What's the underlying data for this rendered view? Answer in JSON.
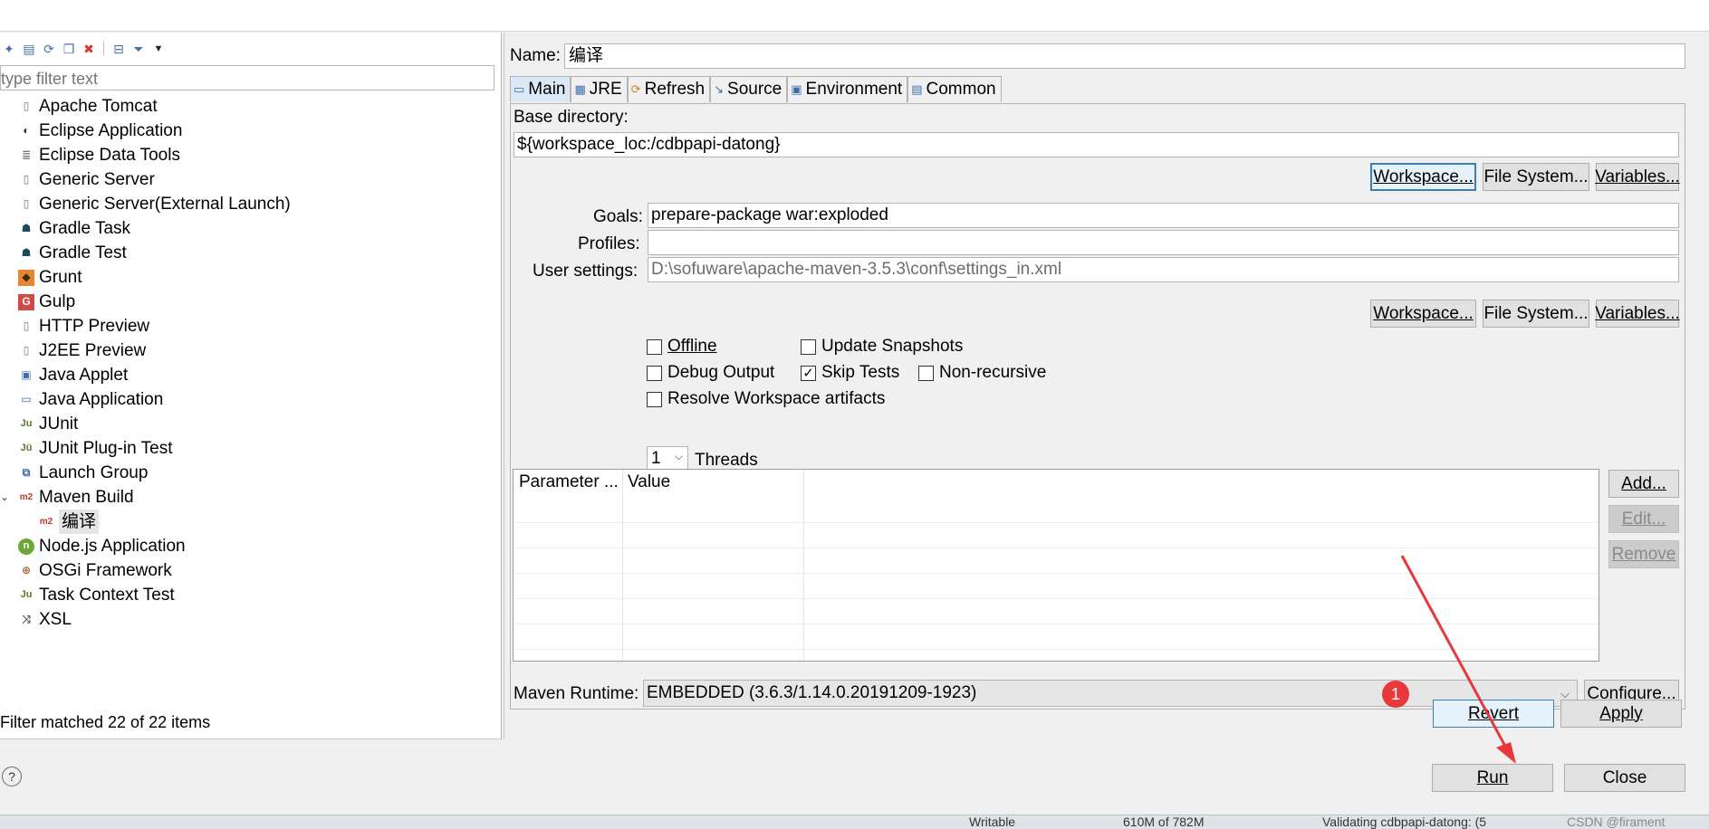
{
  "left_panel": {
    "filter_placeholder": "type filter text",
    "items": [
      {
        "label": "Apache Tomcat",
        "icon": "server-icon"
      },
      {
        "label": "Eclipse Application",
        "icon": "eclipse-icon"
      },
      {
        "label": "Eclipse Data Tools",
        "icon": "database-icon"
      },
      {
        "label": "Generic Server",
        "icon": "server-icon"
      },
      {
        "label": "Generic Server(External Launch)",
        "icon": "server-icon"
      },
      {
        "label": "Gradle Task",
        "icon": "gradle-icon"
      },
      {
        "label": "Gradle Test",
        "icon": "gradle-icon"
      },
      {
        "label": "Grunt",
        "icon": "grunt-icon"
      },
      {
        "label": "Gulp",
        "icon": "gulp-icon"
      },
      {
        "label": "HTTP Preview",
        "icon": "server-icon"
      },
      {
        "label": "J2EE Preview",
        "icon": "server-icon"
      },
      {
        "label": "Java Applet",
        "icon": "applet-icon"
      },
      {
        "label": "Java Application",
        "icon": "java-app-icon"
      },
      {
        "label": "JUnit",
        "icon": "junit-icon"
      },
      {
        "label": "JUnit Plug-in Test",
        "icon": "junit-plugin-icon"
      },
      {
        "label": "Launch Group",
        "icon": "launch-group-icon"
      },
      {
        "label": "Maven Build",
        "icon": "maven-icon"
      },
      {
        "label": "编译",
        "icon": "maven-icon"
      },
      {
        "label": "Node.js Application",
        "icon": "nodejs-icon"
      },
      {
        "label": "OSGi Framework",
        "icon": "osgi-icon"
      },
      {
        "label": "Task Context Test",
        "icon": "junit-icon"
      },
      {
        "label": "XSL",
        "icon": "xsl-icon"
      }
    ],
    "status": "Filter matched 22 of 22 items"
  },
  "config": {
    "name_label": "Name:",
    "name_value": "编译",
    "tabs": [
      "Main",
      "JRE",
      "Refresh",
      "Source",
      "Environment",
      "Common"
    ],
    "base_directory_label": "Base directory:",
    "base_directory_value": "${workspace_loc:/cdbpapi-datong}",
    "workspace_btn": "Workspace...",
    "file_system_btn": "File System...",
    "variables_btn": "Variables...",
    "goals_label": "Goals:",
    "goals_value": "prepare-package war:exploded",
    "profiles_label": "Profiles:",
    "profiles_value": "",
    "user_settings_label": "User settings:",
    "user_settings_value": "D:\\sofuware\\apache-maven-3.5.3\\conf\\settings_in.xml",
    "offline_label": "Offline",
    "update_snapshots_label": "Update Snapshots",
    "debug_output_label": "Debug Output",
    "skip_tests_label": "Skip Tests",
    "non_recursive_label": "Non-recursive",
    "resolve_workspace_label": "Resolve Workspace artifacts",
    "threads_value": "1",
    "threads_label": "Threads",
    "table_col_parameter": "Parameter ...",
    "table_col_value": "Value",
    "add_btn": "Add...",
    "edit_btn": "Edit...",
    "remove_btn": "Remove",
    "maven_runtime_label": "Maven Runtime:",
    "maven_runtime_value": "EMBEDDED (3.6.3/1.14.0.20191209-1923)",
    "configure_btn": "Configure...",
    "revert_btn": "Revert",
    "apply_btn": "Apply"
  },
  "footer": {
    "run_btn": "Run",
    "close_btn": "Close",
    "help_icon": "?",
    "annotation_number": "1"
  },
  "taskbar": {
    "writable": "Writable",
    "memory": "610M of 782M",
    "validating": "Validating cdbpapi-datong: (5",
    "watermark": "CSDN @firament"
  },
  "colors": {
    "accent": "#3c7fb1",
    "badge": "#e8383b",
    "arrow": "#e8383b"
  }
}
